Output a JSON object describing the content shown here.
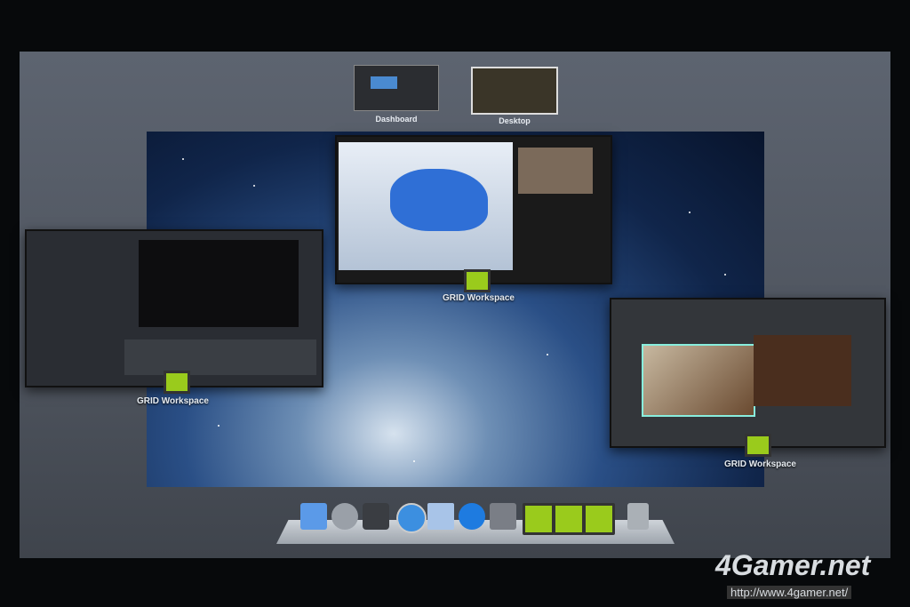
{
  "spaces": [
    {
      "label": "Dashboard"
    },
    {
      "label": "Desktop"
    }
  ],
  "windows": [
    {
      "label": "GRID Workspace"
    },
    {
      "label": "GRID Workspace"
    },
    {
      "label": "GRID Workspace"
    }
  ],
  "dock": [
    "finder-icon",
    "launchpad-icon",
    "mission-control-icon",
    "safari-icon",
    "mail-icon",
    "itunes-icon",
    "system-preferences-icon",
    "grid-workspace-icon",
    "grid-workspace-icon",
    "grid-workspace-icon",
    "trash-icon"
  ],
  "watermark": {
    "brand": "4Gamer.net",
    "url": "http://www.4gamer.net/"
  },
  "colors": {
    "grid_green": "#9acb1c",
    "desktop_blue": "#2a4f86"
  }
}
